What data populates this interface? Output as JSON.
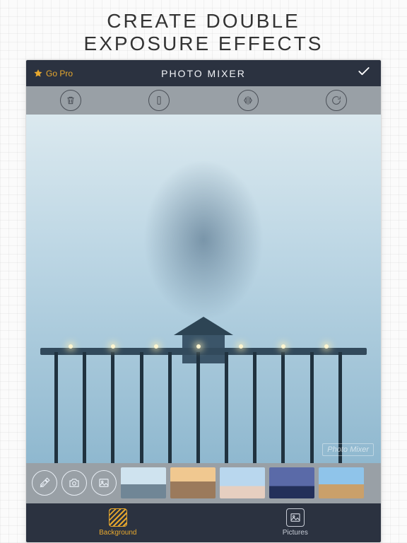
{
  "promo": {
    "line1": "CREATE  DOUBLE",
    "line2": "EXPOSURE  EFFECTS"
  },
  "header": {
    "go_pro_label": "Go Pro",
    "app_title": "PHOTO MIXER"
  },
  "toolbar": {
    "delete": "Delete",
    "flip_v": "Flip vertical",
    "flip_h": "Flip horizontal",
    "rotate": "Rotate"
  },
  "canvas": {
    "watermark": "Photo Mixer"
  },
  "source_controls": {
    "eyedropper": "Eyedropper",
    "camera": "Camera",
    "gallery": "Gallery"
  },
  "thumbnails": [
    {
      "name": "thumb-pier"
    },
    {
      "name": "thumb-colosseum"
    },
    {
      "name": "thumb-boardwalk"
    },
    {
      "name": "thumb-mountain"
    },
    {
      "name": "thumb-road"
    }
  ],
  "bottom_nav": {
    "background_label": "Background",
    "pictures_label": "Pictures",
    "active": "background"
  }
}
